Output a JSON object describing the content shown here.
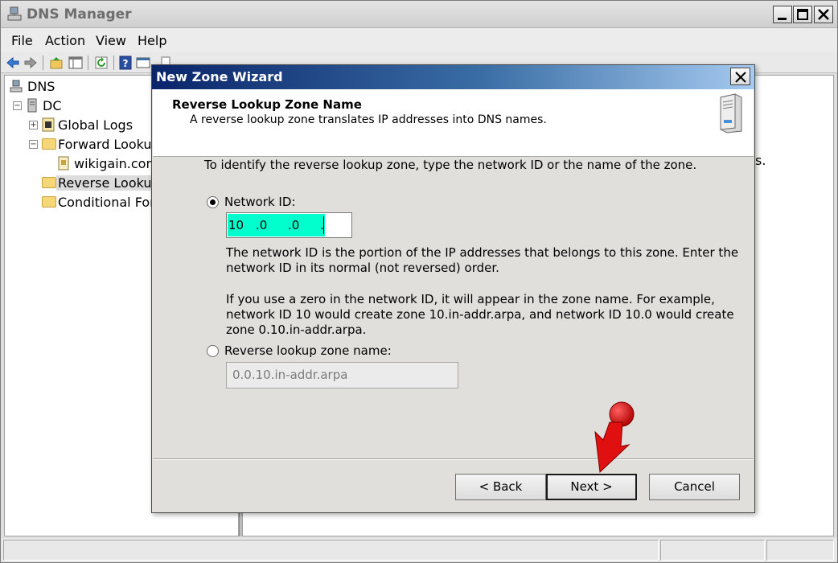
{
  "window": {
    "title": "DNS Manager"
  },
  "menu": [
    "File",
    "Action",
    "View",
    "Help"
  ],
  "tree": {
    "root": "DNS",
    "server": "DC",
    "items": [
      "Global Logs",
      "Forward Lookup",
      "wikigain.com",
      "Reverse Lookup",
      "Conditional Forw"
    ]
  },
  "right_pane": {
    "visible_fragment": "s."
  },
  "dialog": {
    "title": "New Zone Wizard",
    "header_title": "Reverse Lookup Zone Name",
    "header_subtitle": "A reverse lookup zone translates IP addresses into DNS names.",
    "instruction": "To identify the reverse lookup zone, type the network ID or the name of the zone.",
    "network_id_label": "Network ID:",
    "network_id_octets": [
      "10",
      ".0",
      ".0",
      "."
    ],
    "network_id_selected": true,
    "desc1_line1": "The network ID is the portion of the IP addresses that belongs to this zone. Enter the",
    "desc1_line2": "network ID in its normal (not reversed) order.",
    "desc2_line1": "If you use a zero in the network ID, it will appear in the zone name. For example,",
    "desc2_line2": "network ID 10 would create zone 10.in-addr.arpa, and network ID 10.0 would create",
    "desc2_line3": "zone 0.10.in-addr.arpa.",
    "zone_name_label": "Reverse lookup zone name:",
    "zone_name_value": "0.0.10.in-addr.arpa",
    "buttons": {
      "back": "< Back",
      "next": "Next >",
      "cancel": "Cancel"
    }
  },
  "colors": {
    "dialog_title_start": "#0a246a",
    "ip_highlight": "#00ffcc",
    "annotation_arrow": "#e01010"
  },
  "icons": [
    "dns-manager-icon",
    "back-arrow-icon",
    "forward-arrow-icon",
    "up-folder-icon",
    "show-hide-tree-icon",
    "refresh-icon",
    "help-icon",
    "properties-icon",
    "server-icon",
    "red-pointer-arrow-icon"
  ]
}
